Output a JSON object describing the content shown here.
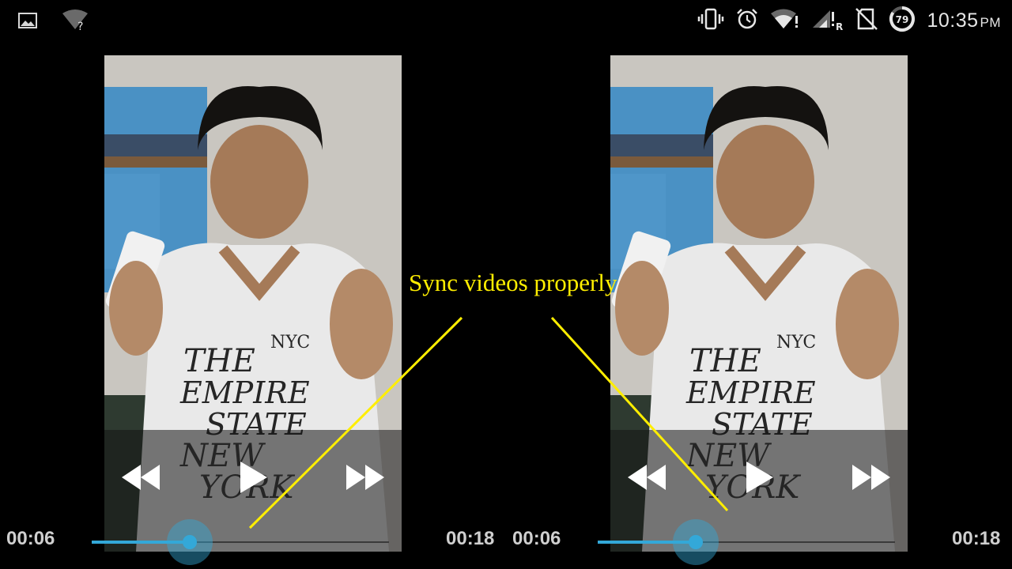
{
  "status_bar": {
    "left_icons": [
      "image-notification-icon",
      "wifi-unknown-icon"
    ],
    "right_icons": [
      "vibrate-icon",
      "alarm-icon",
      "wifi-icon",
      "signal-roaming-icon",
      "no-sim-icon",
      "battery-icon"
    ],
    "battery_level": "79",
    "roaming_indicator": "R",
    "time": "10:35",
    "ampm": "PM"
  },
  "players": [
    {
      "current_time": "00:06",
      "total_time": "00:18",
      "progress": 0.33,
      "controls": [
        "rewind-icon",
        "play-icon",
        "fast-forward-icon"
      ]
    },
    {
      "current_time": "00:06",
      "total_time": "00:18",
      "progress": 0.33,
      "controls": [
        "rewind-icon",
        "play-icon",
        "fast-forward-icon"
      ]
    }
  ],
  "annotation": {
    "text": "Sync videos properly",
    "color": "#ffee00"
  },
  "colors": {
    "accent": "#33a8d8",
    "background": "#000000"
  }
}
